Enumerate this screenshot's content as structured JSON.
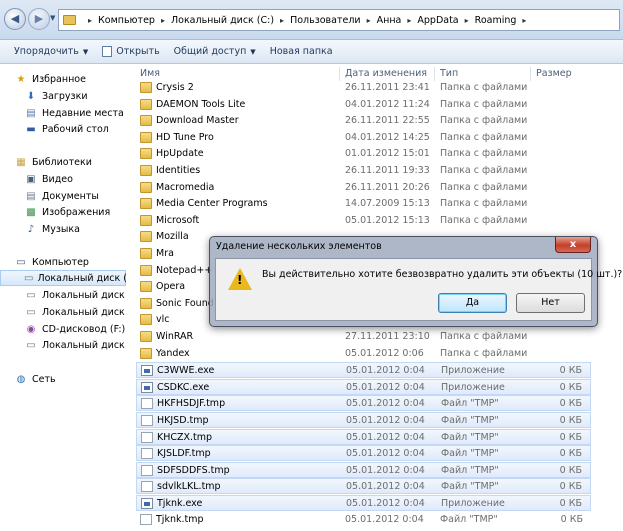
{
  "address": {
    "crumbs": [
      "Компьютер",
      "Локальный диск (C:)",
      "Пользователи",
      "Анна",
      "AppData",
      "Roaming"
    ]
  },
  "toolbar": {
    "organize": "Упорядочить",
    "open": "Открыть",
    "share": "Общий доступ",
    "new_folder": "Новая папка"
  },
  "nav": {
    "favorites": "Избранное",
    "downloads": "Загрузки",
    "recent": "Недавние места",
    "desktop": "Рабочий стол",
    "libraries": "Библиотеки",
    "video": "Видео",
    "documents": "Документы",
    "images": "Изображения",
    "music": "Музыка",
    "computer": "Компьютер",
    "drive1": "Локальный диск (C",
    "drive2": "Локальный диск (D",
    "drive3": "Локальный диск (E",
    "drive4": "CD-дисковод (F:) H",
    "drive5": "Локальный диск (H",
    "network": "Сеть"
  },
  "columns": {
    "name": "Имя",
    "date": "Дата изменения",
    "type": "Тип",
    "size": "Размер"
  },
  "files": [
    {
      "name": "Crysis 2",
      "date": "26.11.2011 23:41",
      "type": "Папка с файлами",
      "size": "",
      "kind": "folder"
    },
    {
      "name": "DAEMON Tools Lite",
      "date": "04.01.2012 11:24",
      "type": "Папка с файлами",
      "size": "",
      "kind": "folder"
    },
    {
      "name": "Download Master",
      "date": "26.11.2011 22:55",
      "type": "Папка с файлами",
      "size": "",
      "kind": "folder"
    },
    {
      "name": "HD Tune Pro",
      "date": "04.01.2012 14:25",
      "type": "Папка с файлами",
      "size": "",
      "kind": "folder"
    },
    {
      "name": "HpUpdate",
      "date": "01.01.2012 15:01",
      "type": "Папка с файлами",
      "size": "",
      "kind": "folder"
    },
    {
      "name": "Identities",
      "date": "26.11.2011 19:33",
      "type": "Папка с файлами",
      "size": "",
      "kind": "folder"
    },
    {
      "name": "Macromedia",
      "date": "26.11.2011 20:26",
      "type": "Папка с файлами",
      "size": "",
      "kind": "folder"
    },
    {
      "name": "Media Center Programs",
      "date": "14.07.2009 15:13",
      "type": "Папка с файлами",
      "size": "",
      "kind": "folder"
    },
    {
      "name": "Microsoft",
      "date": "05.01.2012 15:13",
      "type": "Папка с файлами",
      "size": "",
      "kind": "folder"
    },
    {
      "name": "Mozilla",
      "date": "",
      "type": "",
      "size": "",
      "kind": "folder"
    },
    {
      "name": "Mra",
      "date": "",
      "type": "",
      "size": "",
      "kind": "folder"
    },
    {
      "name": "Notepad++",
      "date": "",
      "type": "",
      "size": "",
      "kind": "folder"
    },
    {
      "name": "Opera",
      "date": "",
      "type": "",
      "size": "",
      "kind": "folder"
    },
    {
      "name": "Sonic Found",
      "date": "",
      "type": "",
      "size": "",
      "kind": "folder"
    },
    {
      "name": "vlc",
      "date": "",
      "type": "",
      "size": "",
      "kind": "folder"
    },
    {
      "name": "WinRAR",
      "date": "27.11.2011 23:10",
      "type": "Папка с файлами",
      "size": "",
      "kind": "folder"
    },
    {
      "name": "Yandex",
      "date": "05.01.2012 0:06",
      "type": "Папка с файлами",
      "size": "",
      "kind": "folder"
    },
    {
      "name": "C3WWE.exe",
      "date": "05.01.2012 0:04",
      "type": "Приложение",
      "size": "0 КБ",
      "kind": "exe"
    },
    {
      "name": "CSDKC.exe",
      "date": "05.01.2012 0:04",
      "type": "Приложение",
      "size": "0 КБ",
      "kind": "exe"
    },
    {
      "name": "HKFHSDJF.tmp",
      "date": "05.01.2012 0:04",
      "type": "Файл \"TMP\"",
      "size": "0 КБ",
      "kind": "tmp"
    },
    {
      "name": "HKJSD.tmp",
      "date": "05.01.2012 0:04",
      "type": "Файл \"TMP\"",
      "size": "0 КБ",
      "kind": "tmp"
    },
    {
      "name": "KHCZX.tmp",
      "date": "05.01.2012 0:04",
      "type": "Файл \"TMP\"",
      "size": "0 КБ",
      "kind": "tmp"
    },
    {
      "name": "KJSLDF.tmp",
      "date": "05.01.2012 0:04",
      "type": "Файл \"TMP\"",
      "size": "0 КБ",
      "kind": "tmp"
    },
    {
      "name": "SDFSDDFS.tmp",
      "date": "05.01.2012 0:04",
      "type": "Файл \"TMP\"",
      "size": "0 КБ",
      "kind": "tmp"
    },
    {
      "name": "sdvlkLKL.tmp",
      "date": "05.01.2012 0:04",
      "type": "Файл \"TMP\"",
      "size": "0 КБ",
      "kind": "tmp"
    },
    {
      "name": "Tjknk.exe",
      "date": "05.01.2012 0:04",
      "type": "Приложение",
      "size": "0 КБ",
      "kind": "exe"
    },
    {
      "name": "Tjknk.tmp",
      "date": "05.01.2012 0:04",
      "type": "Файл \"TMP\"",
      "size": "0 КБ",
      "kind": "tmp"
    }
  ],
  "dialog": {
    "title": "Удаление нескольких элементов",
    "close": "x",
    "message": "Вы действительно хотите безвозвратно удалить эти объекты (10 шт.)?",
    "yes": "Да",
    "no": "Нет"
  }
}
